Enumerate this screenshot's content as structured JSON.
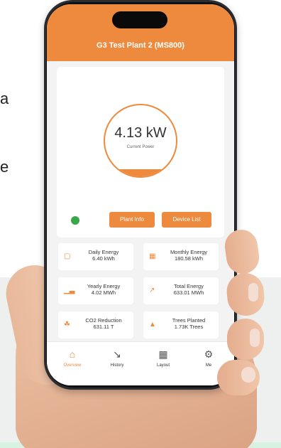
{
  "app": {
    "title": "G3 Test Plant 2 (MS800)"
  },
  "side_text": {
    "line1": "a",
    "line2": "e"
  },
  "power": {
    "value": "4.13 kW",
    "caption": "Current Power",
    "level": 0.1
  },
  "status": {
    "online_color": "#3aa84a"
  },
  "buttons": {
    "plant_info": "Plant Info",
    "device_list": "Device List"
  },
  "stats": [
    {
      "icon": "calendar-icon",
      "label": "Daily Energy",
      "value": "6.40 kWh"
    },
    {
      "icon": "calendar-icon",
      "label": "Monthly Energy",
      "value": "180.58 kWh"
    },
    {
      "icon": "bar-chart-icon",
      "label": "Yearly Energy",
      "value": "4.02 MWh"
    },
    {
      "icon": "trend-icon",
      "label": "Total Energy",
      "value": "633.01 MWh"
    },
    {
      "icon": "leaf-icon",
      "label": "CO2 Reduction",
      "value": "631.11 T"
    },
    {
      "icon": "tree-icon",
      "label": "Trees Planted",
      "value": "1.73K Trees"
    }
  ],
  "tabs": [
    {
      "icon": "home-icon",
      "label": "Overview"
    },
    {
      "icon": "chart-icon",
      "label": "History"
    },
    {
      "icon": "grid-icon",
      "label": "Layout"
    },
    {
      "icon": "settings-icon",
      "label": "Me"
    }
  ],
  "colors": {
    "accent": "#ee8a3d",
    "background": "#f3f3f3"
  }
}
